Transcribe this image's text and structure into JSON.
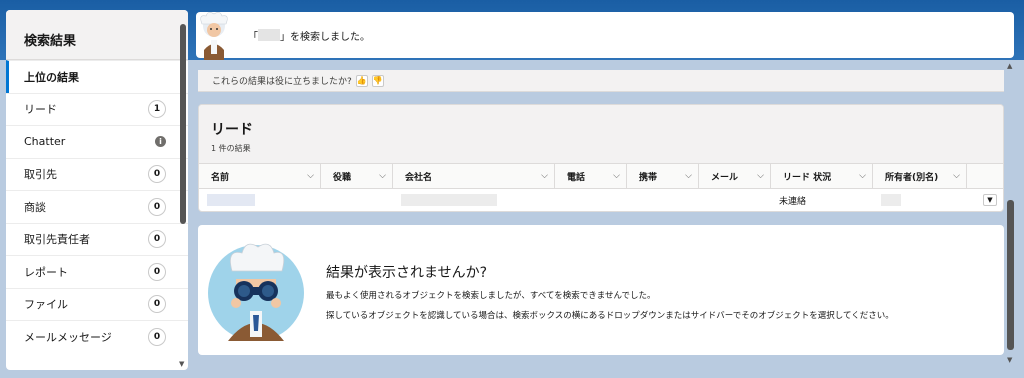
{
  "sidebar": {
    "title": "検索結果",
    "items": [
      {
        "label": "上位の結果",
        "badge": "",
        "active": true
      },
      {
        "label": "リード",
        "badge": "1"
      },
      {
        "label": "Chatter",
        "badge": "i"
      },
      {
        "label": "取引先",
        "badge": "0"
      },
      {
        "label": "商談",
        "badge": "0"
      },
      {
        "label": "取引先責任者",
        "badge": "0"
      },
      {
        "label": "レポート",
        "badge": "0"
      },
      {
        "label": "ファイル",
        "badge": "0"
      },
      {
        "label": "メールメッセージ",
        "badge": "0"
      }
    ]
  },
  "notification": {
    "open_quote": "「",
    "close_text": "」を検索しました。"
  },
  "feedback": {
    "question": "これらの結果は役に立ちましたか?",
    "thumb_up_icon": "thumbs-up-icon",
    "thumb_down_icon": "thumbs-down-icon"
  },
  "results": {
    "title": "リード",
    "count": "1 件の結果",
    "columns": [
      "名前",
      "役職",
      "会社名",
      "電話",
      "携帯",
      "メール",
      "リード 状況",
      "所有者(別名)"
    ],
    "row": {
      "status": "未連絡"
    }
  },
  "empty_state": {
    "title": "結果が表示されませんか?",
    "line1": "最もよく使用されるオブジェクトを検索しましたが、すべてを検索できませんでした。",
    "line2": "探しているオブジェクトを認識している場合は、検索ボックスの横にあるドロップダウンまたはサイドバーでそのオブジェクトを選択してください。"
  },
  "colors": {
    "accent": "#0176d3",
    "background": "#b9cbe0",
    "header": "#1b5fa3"
  }
}
